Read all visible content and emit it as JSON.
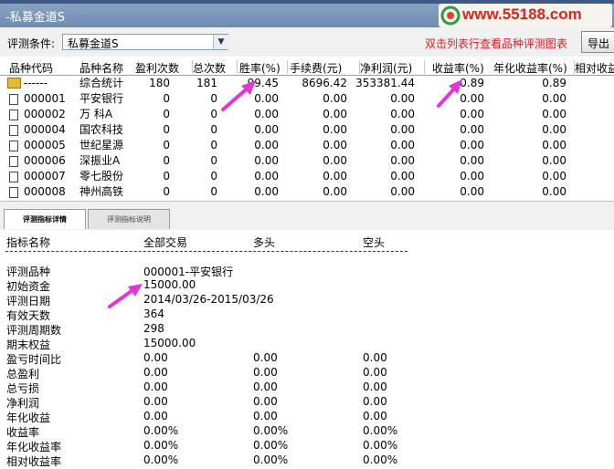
{
  "window": {
    "title": "-私募金道S",
    "logo_text": "www.55188.com"
  },
  "toolbar": {
    "criteria_label": "评测条件:",
    "criteria_value": "私募金道S",
    "hint": "双击列表行查看品种评测图表",
    "export_label": "导出"
  },
  "table": {
    "headers": [
      "品种代码",
      "品种名称",
      "盈利次数",
      "总次数",
      "胜率(%)",
      "手续费(元)",
      "净利润(元)",
      "收益率(%)",
      "年化收益率(%)",
      "相对收益"
    ],
    "rows": [
      {
        "code": "------",
        "name": "综合统计",
        "wins": "180",
        "total": "181",
        "win_rate": "99.45",
        "fee": "8696.42",
        "net": "353381.44",
        "ret": "0.89",
        "ann": "0.89",
        "icon": "folder-icon"
      },
      {
        "code": "000001",
        "name": "平安银行",
        "wins": "0",
        "total": "0",
        "win_rate": "0.00",
        "fee": "0.00",
        "net": "0.00",
        "ret": "0.00",
        "ann": "0.00",
        "icon": "document-icon"
      },
      {
        "code": "000002",
        "name": "万  科A",
        "wins": "0",
        "total": "0",
        "win_rate": "0.00",
        "fee": "0.00",
        "net": "0.00",
        "ret": "0.00",
        "ann": "0.00",
        "icon": "document-icon"
      },
      {
        "code": "000004",
        "name": "国农科技",
        "wins": "0",
        "total": "0",
        "win_rate": "0.00",
        "fee": "0.00",
        "net": "0.00",
        "ret": "0.00",
        "ann": "0.00",
        "icon": "document-icon"
      },
      {
        "code": "000005",
        "name": "世纪星源",
        "wins": "0",
        "total": "0",
        "win_rate": "0.00",
        "fee": "0.00",
        "net": "0.00",
        "ret": "0.00",
        "ann": "0.00",
        "icon": "document-icon"
      },
      {
        "code": "000006",
        "name": "深振业A",
        "wins": "0",
        "total": "0",
        "win_rate": "0.00",
        "fee": "0.00",
        "net": "0.00",
        "ret": "0.00",
        "ann": "0.00",
        "icon": "document-icon"
      },
      {
        "code": "000007",
        "name": "零七股份",
        "wins": "0",
        "total": "0",
        "win_rate": "0.00",
        "fee": "0.00",
        "net": "0.00",
        "ret": "0.00",
        "ann": "0.00",
        "icon": "document-icon"
      },
      {
        "code": "000008",
        "name": "神州高铁",
        "wins": "0",
        "total": "0",
        "win_rate": "0.00",
        "fee": "0.00",
        "net": "0.00",
        "ret": "0.00",
        "ann": "0.00",
        "icon": "document-icon"
      }
    ]
  },
  "tabs": [
    {
      "label": "评测指标详情",
      "active": true
    },
    {
      "label": "评测指标说明",
      "active": false
    }
  ],
  "details": {
    "headers": [
      "指标名称",
      "全部交易",
      "多头",
      "空头"
    ],
    "rows": [
      {
        "label": "评测品种",
        "all": "000001-平安银行",
        "long": "",
        "short": ""
      },
      {
        "label": "初始资金",
        "all": "15000.00",
        "long": "",
        "short": ""
      },
      {
        "label": "评测日期",
        "all": "2014/03/26-2015/03/26",
        "long": "",
        "short": ""
      },
      {
        "label": "有效天数",
        "all": "364",
        "long": "",
        "short": ""
      },
      {
        "label": "评测周期数",
        "all": "298",
        "long": "",
        "short": ""
      },
      {
        "label": "期末权益",
        "all": "15000.00",
        "long": "",
        "short": ""
      },
      {
        "label": "盈亏时间比",
        "all": "0.00",
        "long": "0.00",
        "short": "0.00"
      },
      {
        "label": "总盈利",
        "all": "0.00",
        "long": "0.00",
        "short": "0.00"
      },
      {
        "label": "总亏损",
        "all": "0.00",
        "long": "0.00",
        "short": "0.00"
      },
      {
        "label": "净利润",
        "all": "0.00",
        "long": "0.00",
        "short": "0.00"
      },
      {
        "label": "年化收益",
        "all": "0.00",
        "long": "0.00",
        "short": "0.00"
      },
      {
        "label": "收益率",
        "all": "0.00%",
        "long": "0.00%",
        "short": "0.00%"
      },
      {
        "label": "年化收益率",
        "all": "0.00%",
        "long": "0.00%",
        "short": "0.00%"
      },
      {
        "label": "相对收益率",
        "all": "0.00%",
        "long": "0.00%",
        "short": "0.00%"
      }
    ]
  },
  "colors": {
    "annotation_arrow": "#e135d8",
    "hint_red": "#e8171f",
    "title_bar": "#7a93b8"
  }
}
